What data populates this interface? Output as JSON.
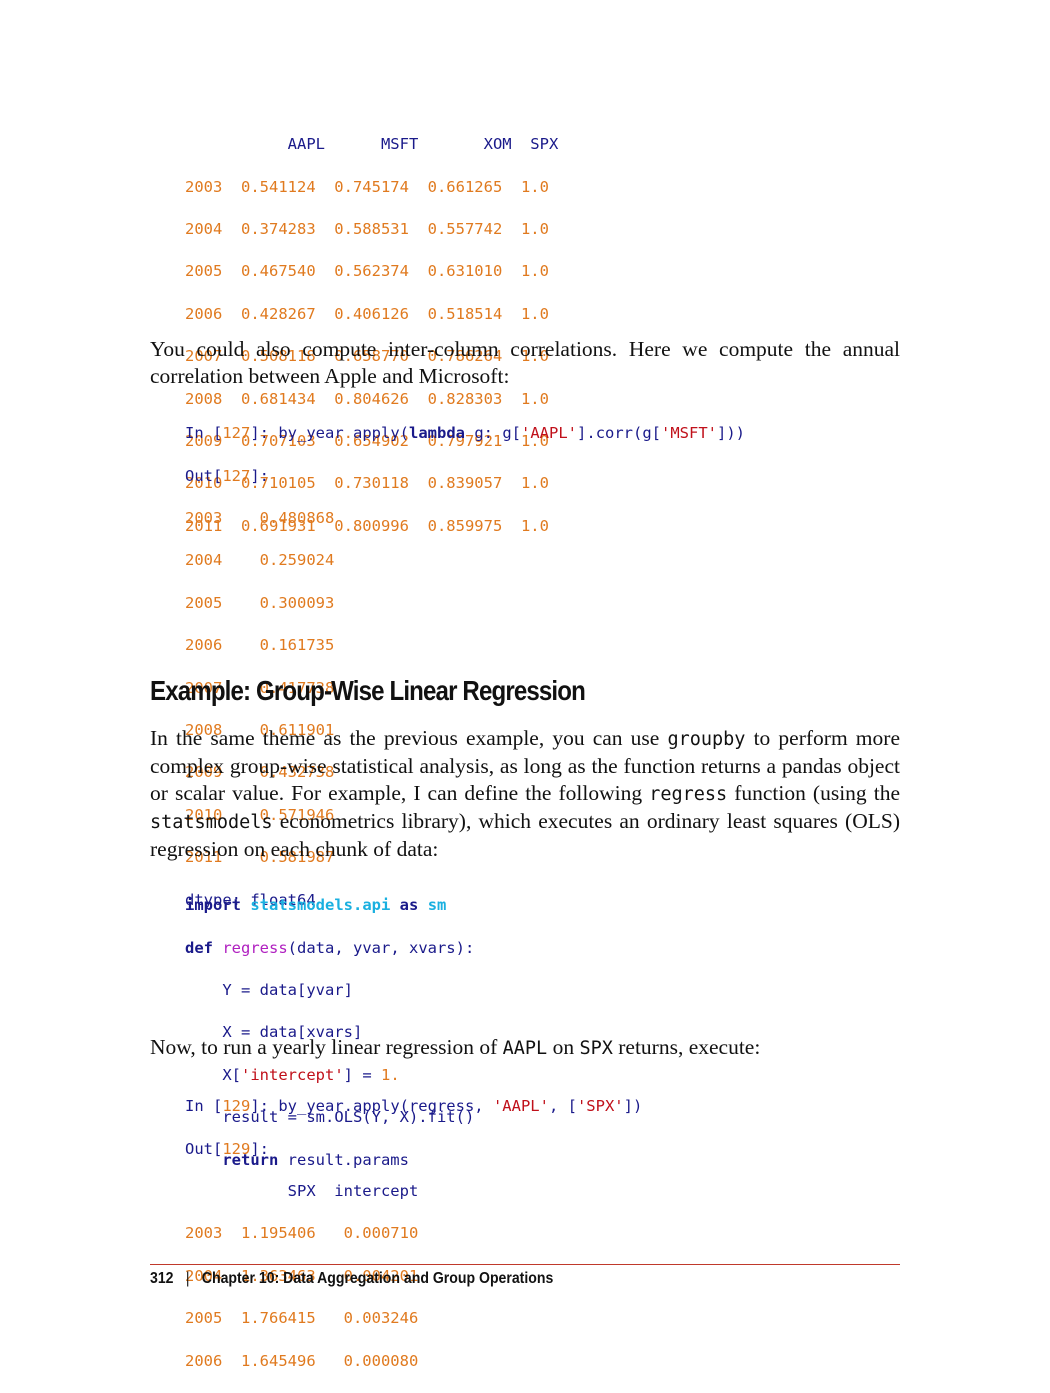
{
  "table1": {
    "header": "           AAPL      MSFT       XOM  SPX",
    "rows": [
      {
        "year": "2003",
        "vals": "  0.541124  0.745174  0.661265  1.0"
      },
      {
        "year": "2004",
        "vals": "  0.374283  0.588531  0.557742  1.0"
      },
      {
        "year": "2005",
        "vals": "  0.467540  0.562374  0.631010  1.0"
      },
      {
        "year": "2006",
        "vals": "  0.428267  0.406126  0.518514  1.0"
      },
      {
        "year": "2007",
        "vals": "  0.508118  0.658770  0.786264  1.0"
      },
      {
        "year": "2008",
        "vals": "  0.681434  0.804626  0.828303  1.0"
      },
      {
        "year": "2009",
        "vals": "  0.707103  0.654902  0.797921  1.0"
      },
      {
        "year": "2010",
        "vals": "  0.710105  0.730118  0.839057  1.0"
      },
      {
        "year": "2011",
        "vals": "  0.691931  0.800996  0.859975  1.0"
      }
    ]
  },
  "para1": "You could also compute inter-column correlations. Here we compute the annual correlation between Apple and Microsoft:",
  "code127": {
    "in_prefix": "In [",
    "in_num": "127",
    "in_suffix": "]: ",
    "obj": "by_year",
    "dot1": ".",
    "method": "apply",
    "open": "(",
    "kw_lambda": "lambda",
    "arg": " g: g[",
    "str1": "'AAPL'",
    "mid": "].",
    "corr": "corr",
    "mid2": "(g[",
    "str2": "'MSFT'",
    "close": "]))",
    "out_prefix": "Out[",
    "out_num": "127",
    "out_suffix": "]:",
    "rows": [
      {
        "year": "2003",
        "val": "    0.480868"
      },
      {
        "year": "2004",
        "val": "    0.259024"
      },
      {
        "year": "2005",
        "val": "    0.300093"
      },
      {
        "year": "2006",
        "val": "    0.161735"
      },
      {
        "year": "2007",
        "val": "    0.417738"
      },
      {
        "year": "2008",
        "val": "    0.611901"
      },
      {
        "year": "2009",
        "val": "    0.432738"
      },
      {
        "year": "2010",
        "val": "    0.571946"
      },
      {
        "year": "2011",
        "val": "    0.581987"
      }
    ],
    "dtype_label": "dtype: ",
    "dtype_val": "float64"
  },
  "heading": "Example: Group-Wise Linear Regression",
  "para2": {
    "t1": "In the same theme as the previous example, you can use ",
    "c1": "groupby",
    "t2": " to perform more complex group-wise statistical analysis, as long as the function returns a pandas object or scalar value. For example, I can define the following ",
    "c2": "regress",
    "t3": " function (using the ",
    "c3": "statsmodels",
    "t4": " econometrics library), which executes an ordinary least squares (OLS) regression on each chunk of data:"
  },
  "code_def": {
    "import_kw": "import",
    "module": "statsmodels.api",
    "as_kw": "as",
    "alias": "sm",
    "def_kw": "def",
    "fname": "regress",
    "params": "(data, yvar, xvars):",
    "line3": "    Y = data[yvar]",
    "line4": "    X = data[xvars]",
    "line5_a": "    X[",
    "line5_str": "'intercept'",
    "line5_b": "] = ",
    "line5_num": "1.",
    "line6_a": "    result = sm",
    "line6_b": ".OLS(Y, X).fit()",
    "return_indent": "    ",
    "return_kw": "return",
    "return_rest": " result.params"
  },
  "para3": {
    "t1": "Now, to run a yearly linear regression of ",
    "c1": "AAPL",
    "t2": " on ",
    "c2": "SPX",
    "t3": " returns, execute:"
  },
  "code129": {
    "in_prefix": "In [",
    "in_num": "129",
    "in_suffix": "]: ",
    "call_a": "by_year",
    "call_b": ".apply(regress, ",
    "str1": "'AAPL'",
    "call_c": ", [",
    "str2": "'SPX'",
    "call_d": "])",
    "out_prefix": "Out[",
    "out_num": "129",
    "out_suffix": "]:",
    "header": "           SPX  intercept",
    "rows": [
      {
        "year": "2003",
        "vals": "  1.195406   0.000710"
      },
      {
        "year": "2004",
        "vals": "  1.363463   0.004201"
      },
      {
        "year": "2005",
        "vals": "  1.766415   0.003246"
      },
      {
        "year": "2006",
        "vals": "  1.645496   0.000080"
      }
    ]
  },
  "footer": {
    "page": "312",
    "sep": "|",
    "chapter": "Chapter 10: Data Aggregation and Group Operations"
  }
}
